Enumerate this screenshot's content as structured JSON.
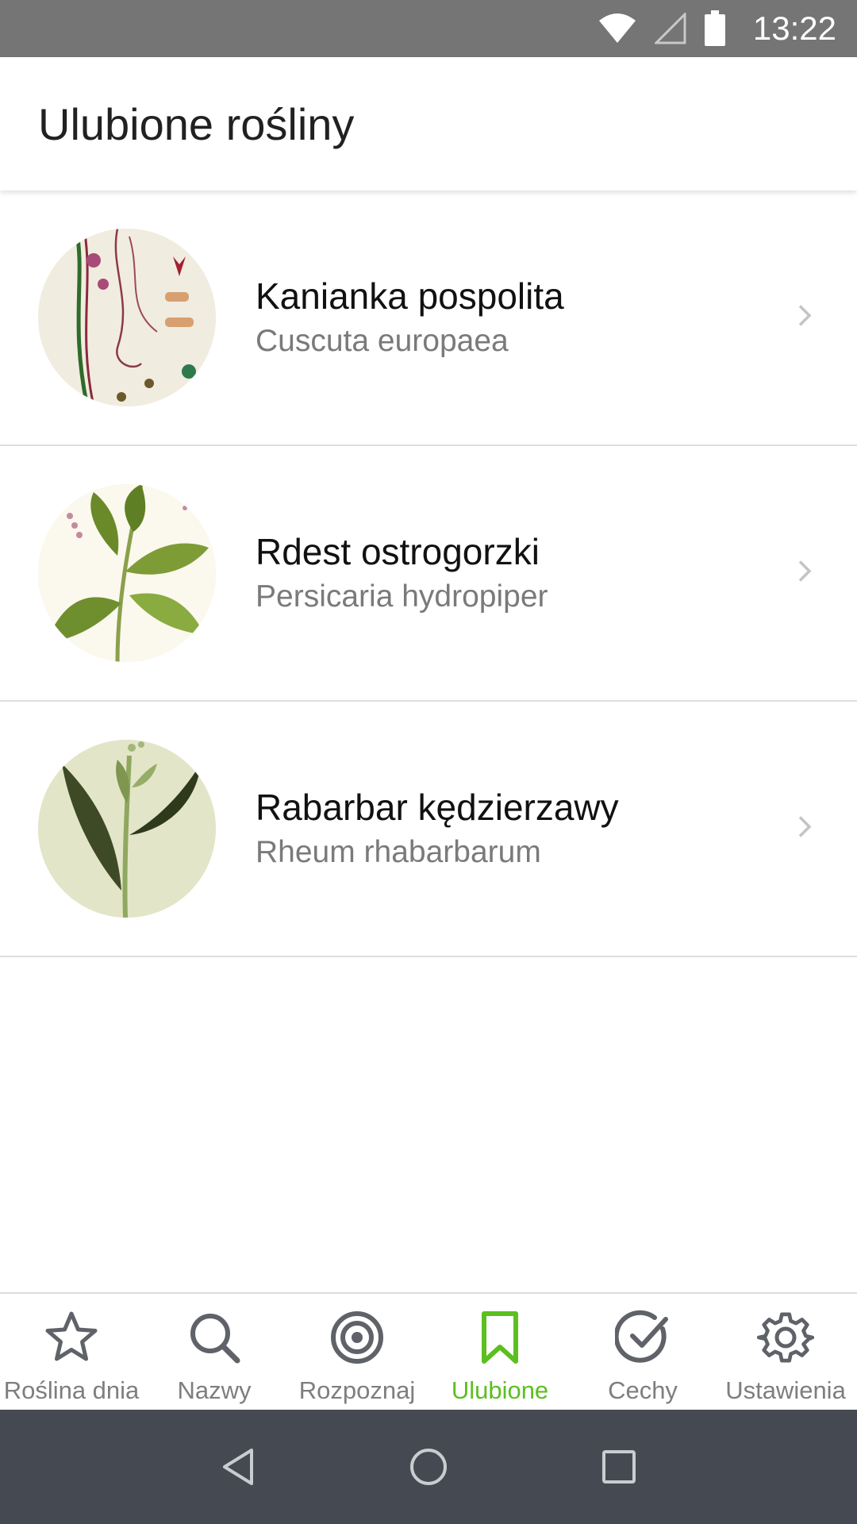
{
  "status_bar": {
    "time": "13:22",
    "icons": [
      "wifi-icon",
      "cellular-signal-icon",
      "battery-icon"
    ]
  },
  "header": {
    "title": "Ulubione rośliny"
  },
  "favorites": [
    {
      "common_name": "Kanianka pospolita",
      "latin_name": "Cuscuta europaea",
      "image": "botanical-illustration-cuscuta"
    },
    {
      "common_name": "Rdest ostrogorzki",
      "latin_name": "Persicaria hydropiper",
      "image": "botanical-illustration-persicaria"
    },
    {
      "common_name": "Rabarbar kędzierzawy",
      "latin_name": "Rheum rhabarbarum",
      "image": "botanical-illustration-rheum"
    }
  ],
  "bottom_nav": {
    "items": [
      {
        "label": "Roślina dnia",
        "icon": "star-icon",
        "active": false
      },
      {
        "label": "Nazwy",
        "icon": "search-icon",
        "active": false
      },
      {
        "label": "Rozpoznaj",
        "icon": "target-icon",
        "active": false
      },
      {
        "label": "Ulubione",
        "icon": "bookmark-icon",
        "active": true
      },
      {
        "label": "Cechy",
        "icon": "check-circle-icon",
        "active": false
      },
      {
        "label": "Ustawienia",
        "icon": "gear-icon",
        "active": false
      }
    ],
    "active_color": "#5cbf1f",
    "inactive_color": "#7e7e7e"
  },
  "system_nav": {
    "buttons": [
      "back-icon",
      "home-icon",
      "recents-icon"
    ]
  }
}
